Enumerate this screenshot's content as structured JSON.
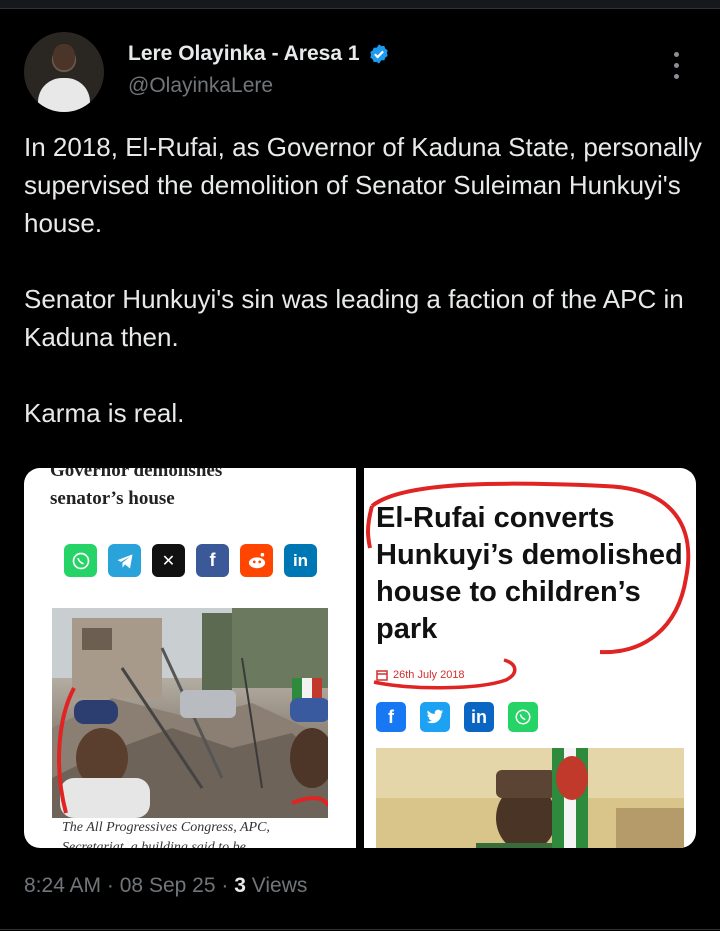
{
  "author": {
    "name": "Lere Olayinka - Aresa 1",
    "handle": "@OlayinkaLere",
    "verified": true
  },
  "tweet": {
    "paragraphs": [
      "In 2018, El-Rufai,  as Governor of Kaduna State, personally supervised the demolition of Senator Suleiman Hunkuyi's house.",
      "Senator Hunkuyi's sin was leading a faction of the APC in Kaduna then.",
      "Karma is real."
    ]
  },
  "media": {
    "left": {
      "title_cut": "Governor demolishes",
      "title": "senator’s house",
      "share_icons": [
        "whatsapp-icon",
        "telegram-icon",
        "x-icon",
        "facebook-icon",
        "reddit-icon",
        "linkedin-icon"
      ],
      "caption": "The All Progressives Congress, APC, Secretariat, a building said to be"
    },
    "right": {
      "headline": "El-Rufai converts Hunkuyi’s demolished house to children’s park",
      "date": "26th July 2018",
      "share_icons": [
        "facebook-icon",
        "twitter-icon",
        "linkedin-icon",
        "whatsapp-icon"
      ]
    }
  },
  "meta": {
    "time": "8:24 AM",
    "date": "08 Sep 25",
    "views_count": "3",
    "views_label": "Views"
  },
  "colors": {
    "background": "#000000",
    "text": "#e7e9ea",
    "muted": "#71767b",
    "verified": "#1d9bf0",
    "annotation_red": "#e02424"
  }
}
